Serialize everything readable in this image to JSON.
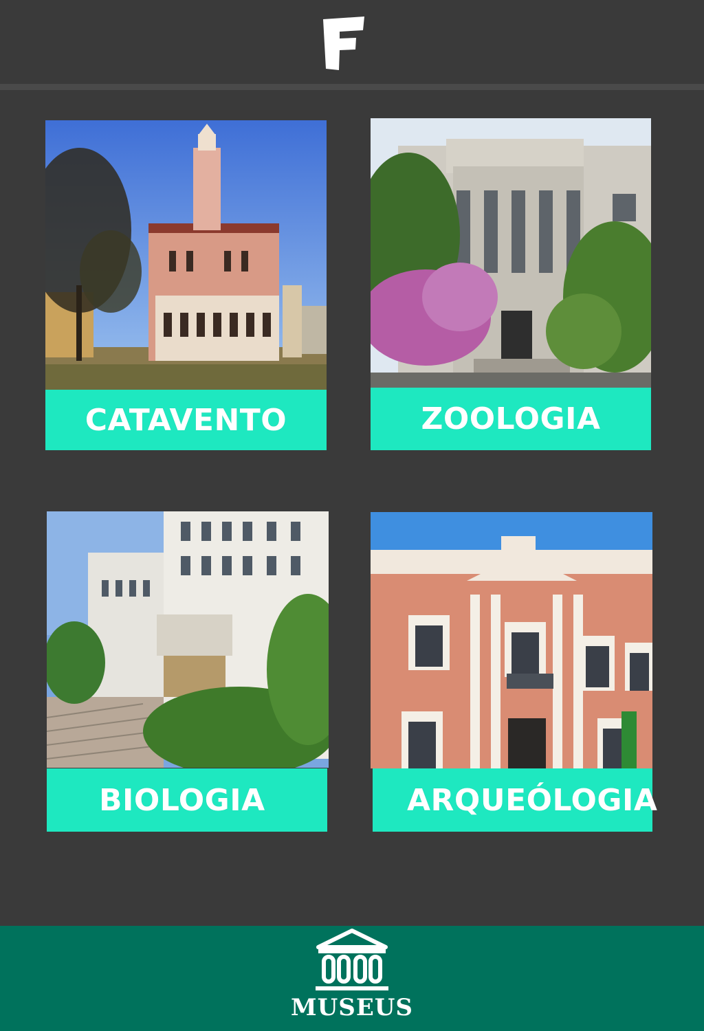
{
  "header": {
    "logo_icon": "f-logo-icon"
  },
  "museums": [
    {
      "label": "CATAVENTO"
    },
    {
      "label": "ZOOLOGIA"
    },
    {
      "label": "BIOLOGIA"
    },
    {
      "label": "ARQUEÓLOGIA"
    }
  ],
  "bottom_nav": {
    "icon": "museum-building-icon",
    "label": "MUSEUS"
  },
  "colors": {
    "background": "#3a3a3a",
    "accent": "#1ee8c0",
    "bottom_bar": "#00725c"
  }
}
